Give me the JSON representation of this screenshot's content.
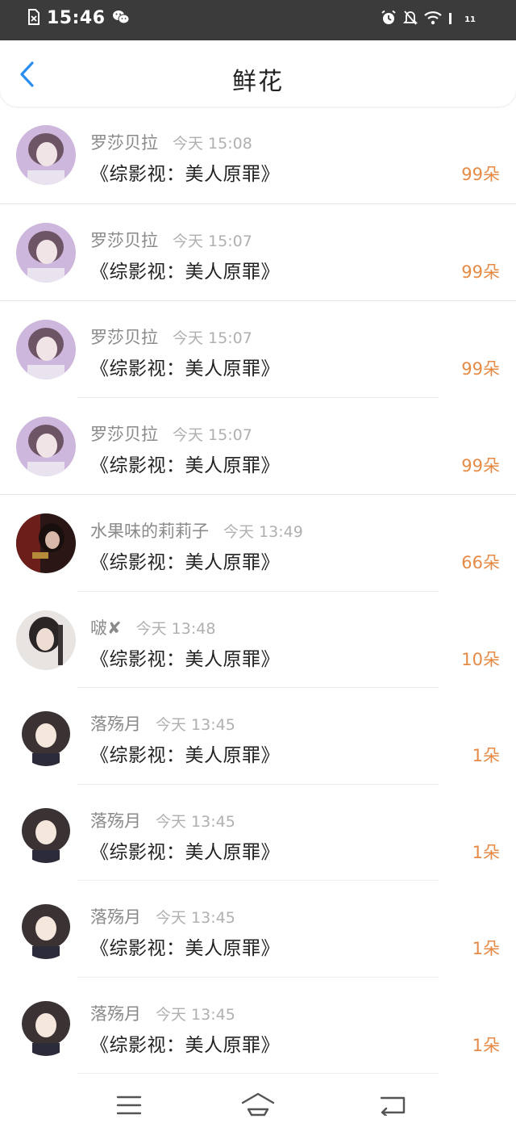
{
  "status_bar": {
    "time": "15:46",
    "signal_badge": "11",
    "icons": [
      "sim-error-icon",
      "wechat-icon",
      "alarm-icon",
      "mute-bell-icon",
      "wifi-icon",
      "signal-icon"
    ]
  },
  "header": {
    "title": "鲜花",
    "back_icon": "chevron-left-icon"
  },
  "colors": {
    "accent": "#2a8ef0",
    "count": "#e68a45",
    "status_bar_bg": "#3b3b3b"
  },
  "items": [
    {
      "user": "罗莎贝拉",
      "time": "今天 15:08",
      "book": "《综影视：美人原罪》",
      "count": "99朵"
    },
    {
      "user": "罗莎贝拉",
      "time": "今天 15:07",
      "book": "《综影视：美人原罪》",
      "count": "99朵"
    },
    {
      "user": "罗莎贝拉",
      "time": "今天 15:07",
      "book": "《综影视：美人原罪》",
      "count": "99朵"
    },
    {
      "user": "罗莎贝拉",
      "time": "今天 15:07",
      "book": "《综影视：美人原罪》",
      "count": "99朵"
    },
    {
      "user": "水果味的莉莉子",
      "time": "今天 13:49",
      "book": "《综影视：美人原罪》",
      "count": "66朵"
    },
    {
      "user": "啵✘",
      "time": "今天 13:48",
      "book": "《综影视：美人原罪》",
      "count": "10朵"
    },
    {
      "user": "落殇月",
      "time": "今天 13:45",
      "book": "《综影视：美人原罪》",
      "count": "1朵"
    },
    {
      "user": "落殇月",
      "time": "今天 13:45",
      "book": "《综影视：美人原罪》",
      "count": "1朵"
    },
    {
      "user": "落殇月",
      "time": "今天 13:45",
      "book": "《综影视：美人原罪》",
      "count": "1朵"
    },
    {
      "user": "落殇月",
      "time": "今天 13:45",
      "book": "《综影视：美人原罪》",
      "count": "1朵"
    }
  ],
  "nav_bar": {
    "icons": [
      "menu-icon",
      "home-icon",
      "back-icon"
    ]
  }
}
